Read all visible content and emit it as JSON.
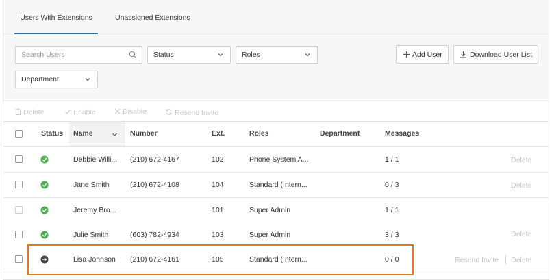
{
  "tabs": [
    {
      "label": "Users With Extensions",
      "active": true
    },
    {
      "label": "Unassigned Extensions",
      "active": false
    }
  ],
  "filters": {
    "search_placeholder": "Search Users",
    "status_label": "Status",
    "roles_label": "Roles",
    "department_label": "Department",
    "add_user_label": "Add User",
    "download_label": "Download User List"
  },
  "bulk_actions": {
    "delete": "Delete",
    "enable": "Enable",
    "disable": "Disable",
    "resend": "Resend Invite"
  },
  "columns": {
    "status": "Status",
    "name": "Name",
    "number": "Number",
    "ext": "Ext.",
    "roles": "Roles",
    "department": "Department",
    "messages": "Messages"
  },
  "rows": [
    {
      "name": "Debbie Willi...",
      "number": "(210) 672-4167",
      "ext": "102",
      "roles": "Phone System A...",
      "department": "",
      "messages": "1 / 1",
      "status": "active",
      "delete_label": "Delete",
      "resend_label": ""
    },
    {
      "name": "Jane Smith",
      "number": "(210) 672-4108",
      "ext": "104",
      "roles": "Standard (Intern...",
      "department": "",
      "messages": "0 / 3",
      "status": "active",
      "delete_label": "Delete",
      "resend_label": ""
    },
    {
      "name": "Jeremy Bro...",
      "number": "",
      "ext": "101",
      "roles": "Super Admin",
      "department": "",
      "messages": "1 / 1",
      "status": "active",
      "delete_label": "",
      "resend_label": ""
    },
    {
      "name": "Julie Smith",
      "number": "(603) 782-4934",
      "ext": "103",
      "roles": "Super Admin",
      "department": "",
      "messages": "3 / 3",
      "status": "active",
      "delete_label": "Delete",
      "resend_label": ""
    },
    {
      "name": "Lisa Johnson",
      "number": "(210) 672-4161",
      "ext": "105",
      "roles": "Standard (Intern...",
      "department": "",
      "messages": "0 / 0",
      "status": "invited",
      "delete_label": "Delete",
      "resend_label": "Resend Invite"
    }
  ],
  "colors": {
    "active_status": "#4caf50",
    "invited_status": "#444444",
    "tab_underline": "#2f6fa8",
    "highlight": "#e07b17"
  }
}
